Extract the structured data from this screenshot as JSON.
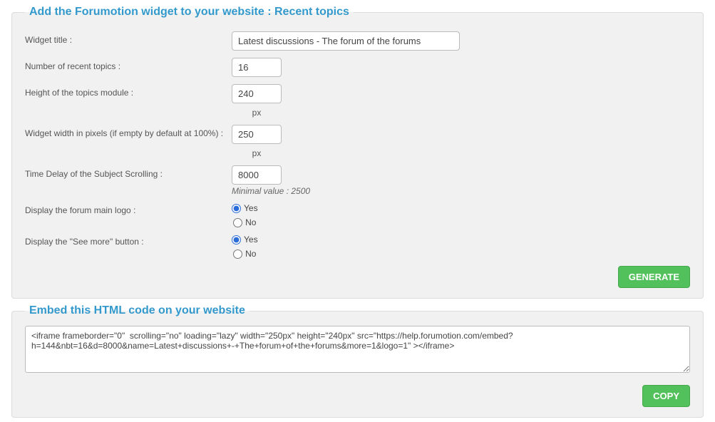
{
  "widget": {
    "legend": "Add the Forumotion widget to your website : Recent topics",
    "labels": {
      "title": "Widget title :",
      "num_topics": "Number of recent topics :",
      "height": "Height of the topics module :",
      "width": "Widget width in pixels (if empty by default at 100%) :",
      "delay": "Time Delay of the Subject Scrolling :",
      "display_logo": "Display the forum main logo :",
      "display_more": "Display the \"See more\" button :"
    },
    "values": {
      "title": "Latest discussions - The forum of the forums",
      "num_topics": "16",
      "height": "240",
      "width": "250",
      "delay": "8000"
    },
    "px_unit": "px",
    "delay_hint": "Minimal value : 2500",
    "yes": "Yes",
    "no": "No",
    "display_logo_selected": "yes",
    "display_more_selected": "yes",
    "generate_label": "GENERATE"
  },
  "embed": {
    "legend": "Embed this HTML code on your website",
    "code": "<iframe frameborder=\"0\"  scrolling=\"no\" loading=\"lazy\" width=\"250px\" height=\"240px\" src=\"https://help.forumotion.com/embed?h=144&nbt=16&d=8000&name=Latest+discussions+-+The+forum+of+the+forums&more=1&logo=1\" ></iframe>",
    "copy_label": "COPY"
  }
}
